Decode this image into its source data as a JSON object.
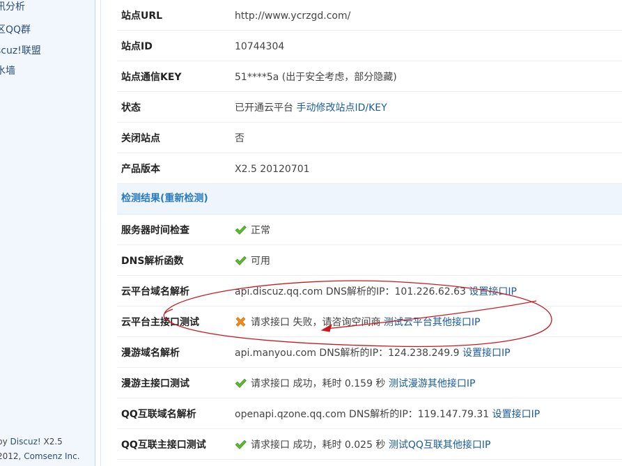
{
  "sidebar": {
    "items": [
      {
        "label": "讯分析"
      },
      {
        "label": "区QQ群"
      },
      {
        "label": "scuz!联盟"
      },
      {
        "label": "水墙"
      }
    ],
    "footer": {
      "powered_prefix": "by",
      "powered_name": "Discuz!",
      "version": "X2.5",
      "copyright_year": "2012,",
      "company": "Comsenz Inc."
    }
  },
  "info_rows": [
    {
      "label": "站点URL",
      "value": "http://www.ycrzgd.com/"
    },
    {
      "label": "站点ID",
      "value": "10744304"
    },
    {
      "label": "站点通信KEY",
      "value": "51****5a (出于安全考虑，部分隐藏)"
    },
    {
      "label": "状态",
      "value": "已开通云平台",
      "link": "手动修改站点ID/KEY"
    },
    {
      "label": "关闭站点",
      "value": "否"
    },
    {
      "label": "产品版本",
      "value": "X2.5 20120701"
    }
  ],
  "check_section": {
    "title": "检测结果(重新检测)"
  },
  "check_rows": [
    {
      "label": "服务器时间检查",
      "status": "ok",
      "value": "正常"
    },
    {
      "label": "DNS解析函数",
      "status": "ok",
      "value": "可用"
    },
    {
      "label": "云平台域名解析",
      "status": "none",
      "value": "api.discuz.qq.com DNS解析的IP：101.226.62.63",
      "link": "设置接口IP"
    },
    {
      "label": "云平台主接口测试",
      "status": "fail",
      "value": "请求接口 失败，请咨询空间商",
      "link": "测试云平台其他接口IP"
    },
    {
      "label": "漫游域名解析",
      "status": "none",
      "value": "api.manyou.com DNS解析的IP：124.238.249.9",
      "link": "设置接口IP"
    },
    {
      "label": "漫游主接口测试",
      "status": "ok",
      "value": "请求接口 成功，耗时 0.159 秒",
      "link": "测试漫游其他接口IP"
    },
    {
      "label": "QQ互联域名解析",
      "status": "none",
      "value": "openapi.qzone.qq.com DNS解析的IP：119.147.79.31",
      "link": "设置接口IP"
    },
    {
      "label": "QQ互联主接口测试",
      "status": "ok",
      "value": "请求接口 成功，耗时 0.025 秒",
      "link": "测试QQ互联其他接口IP"
    }
  ],
  "colors": {
    "ok_icon": "#5cb82e",
    "fail_icon": "#f08a1c",
    "link": "#1a5c9c",
    "section_title": "#2a7bbf",
    "annotation": "#c8191e"
  },
  "icons": {
    "ok": "check-icon",
    "fail": "cross-icon"
  }
}
